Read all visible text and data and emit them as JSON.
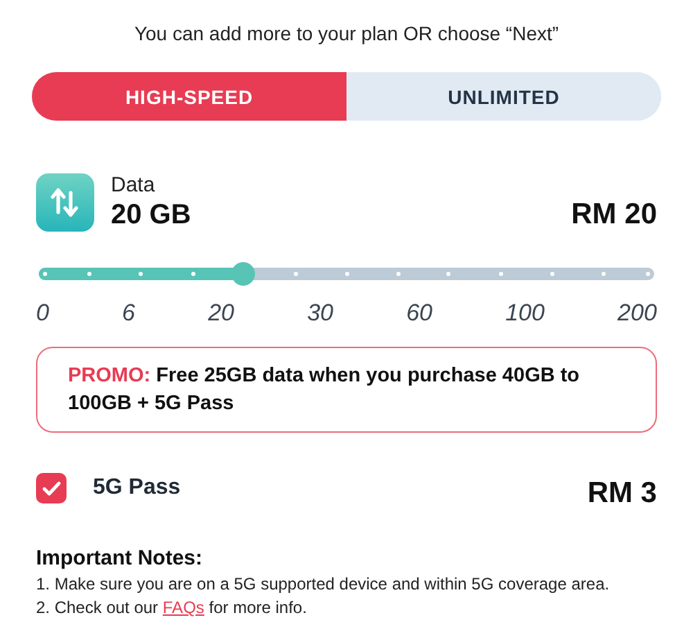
{
  "heading": "You can add more to your plan OR choose “Next”",
  "tabs": [
    {
      "label": "HIGH-SPEED",
      "selected": true
    },
    {
      "label": "UNLIMITED",
      "selected": false
    }
  ],
  "data": {
    "label": "Data",
    "amount": "20 GB",
    "price": "RM 20",
    "slider": {
      "level": 0.333,
      "labels": [
        "0",
        "6",
        "20",
        "30",
        "60",
        "100",
        "200"
      ]
    }
  },
  "promo": {
    "label": "PROMO:",
    "text": "Free 25GB data when you purchase 40GB to 100GB + 5G Pass"
  },
  "addon": {
    "label": "5G Pass",
    "checked": true,
    "price": "RM 3"
  },
  "notes": {
    "title": "Important Notes:",
    "items": [
      {
        "before": "1. Make sure you are on a 5G supported device and within 5G coverage area."
      },
      {
        "before": "2. Check out our ",
        "link": "FAQs",
        "after": " for more info."
      }
    ]
  }
}
